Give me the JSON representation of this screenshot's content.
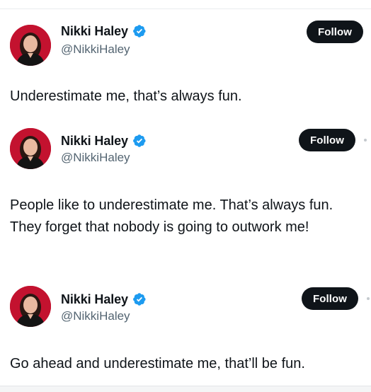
{
  "accent_color": "#1d9bf0",
  "follow_button_color": "#0f1419",
  "tweets": [
    {
      "author": {
        "name": "Nikki Haley",
        "handle": "@NikkiHaley",
        "verified_icon": "verified-badge-icon",
        "avatar": "profile-photo-avatar"
      },
      "follow_label": "Follow",
      "text": "Underestimate me, that’s always fun."
    },
    {
      "author": {
        "name": "Nikki Haley",
        "handle": "@NikkiHaley",
        "verified_icon": "verified-badge-icon",
        "avatar": "profile-photo-avatar"
      },
      "follow_label": "Follow",
      "text": "People like to underestimate me. That’s always fun. They forget that nobody is going to outwork me!"
    },
    {
      "author": {
        "name": "Nikki Haley",
        "handle": "@NikkiHaley",
        "verified_icon": "verified-badge-icon",
        "avatar": "profile-photo-avatar"
      },
      "follow_label": "Follow",
      "text": "Go ahead and underestimate me, that’ll be fun."
    }
  ]
}
